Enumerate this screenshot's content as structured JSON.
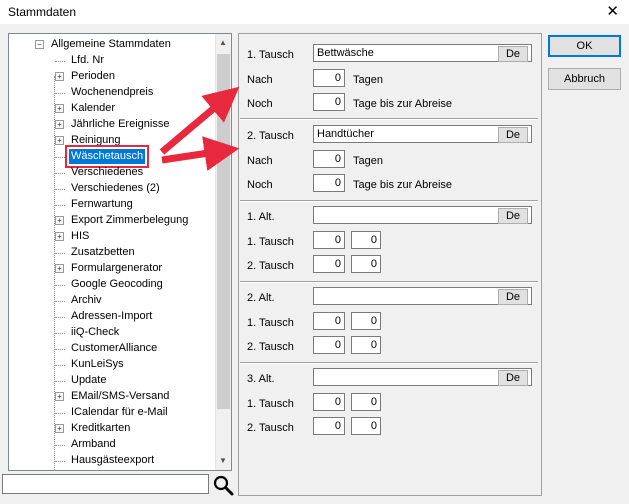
{
  "window": {
    "title": "Stammdaten",
    "close_label": "✕"
  },
  "tree": {
    "root": "Allgemeine Stammdaten",
    "items": [
      {
        "label": "Lfd. Nr",
        "expandable": false
      },
      {
        "label": "Perioden",
        "expandable": true
      },
      {
        "label": "Wochenendpreis",
        "expandable": false
      },
      {
        "label": "Kalender",
        "expandable": true
      },
      {
        "label": "Jährliche Ereignisse",
        "expandable": true
      },
      {
        "label": "Reinigung",
        "expandable": true
      },
      {
        "label": "Wäschetausch",
        "expandable": false,
        "selected": true
      },
      {
        "label": "Verschiedenes",
        "expandable": false
      },
      {
        "label": "Verschiedenes (2)",
        "expandable": false
      },
      {
        "label": "Fernwartung",
        "expandable": false
      },
      {
        "label": "Export Zimmerbelegung",
        "expandable": true
      },
      {
        "label": "HIS",
        "expandable": true
      },
      {
        "label": "Zusatzbetten",
        "expandable": false
      },
      {
        "label": "Formulargenerator",
        "expandable": true
      },
      {
        "label": "Google Geocoding",
        "expandable": false
      },
      {
        "label": "Archiv",
        "expandable": false
      },
      {
        "label": "Adressen-Import",
        "expandable": false
      },
      {
        "label": "iiQ-Check",
        "expandable": false
      },
      {
        "label": "CustomerAlliance",
        "expandable": false
      },
      {
        "label": "KunLeiSys",
        "expandable": false
      },
      {
        "label": "Update",
        "expandable": false
      },
      {
        "label": "EMail/SMS-Versand",
        "expandable": true
      },
      {
        "label": "ICalendar für e-Mail",
        "expandable": false
      },
      {
        "label": "Kreditkarten",
        "expandable": true
      },
      {
        "label": "Armband",
        "expandable": false
      },
      {
        "label": "Hausgästeexport",
        "expandable": false
      }
    ]
  },
  "search": {
    "value": ""
  },
  "sections": {
    "tausch1": {
      "label": "1. Tausch",
      "value": "Bettwäsche",
      "de": "De",
      "nach_label": "Nach",
      "nach_value": "0",
      "nach_unit": "Tagen",
      "noch_label": "Noch",
      "noch_value": "0",
      "noch_unit": "Tage bis zur Abreise"
    },
    "tausch2": {
      "label": "2. Tausch",
      "value": "Handtücher",
      "de": "De",
      "nach_label": "Nach",
      "nach_value": "0",
      "nach_unit": "Tagen",
      "noch_label": "Noch",
      "noch_value": "0",
      "noch_unit": "Tage bis zur Abreise"
    },
    "alts": [
      {
        "label": "1. Alt.",
        "value": "",
        "de": "De",
        "t1_label": "1. Tausch",
        "t1_a": "0",
        "t1_b": "0",
        "t2_label": "2. Tausch",
        "t2_a": "0",
        "t2_b": "0"
      },
      {
        "label": "2. Alt.",
        "value": "",
        "de": "De",
        "t1_label": "1. Tausch",
        "t1_a": "0",
        "t1_b": "0",
        "t2_label": "2. Tausch",
        "t2_a": "0",
        "t2_b": "0"
      },
      {
        "label": "3. Alt.",
        "value": "",
        "de": "De",
        "t1_label": "1. Tausch",
        "t1_a": "0",
        "t1_b": "0",
        "t2_label": "2. Tausch",
        "t2_a": "0",
        "t2_b": "0"
      }
    ]
  },
  "buttons": {
    "ok": "OK",
    "cancel": "Abbruch"
  },
  "colors": {
    "selection": "#0078d7",
    "annotation": "#e8283c"
  }
}
